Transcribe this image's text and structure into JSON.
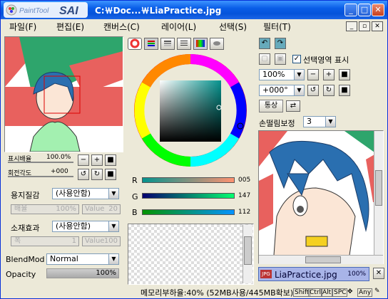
{
  "window": {
    "title": "C:￦Doc...￦LiaPractice.jpg",
    "logo_text": "PaintTool SAI"
  },
  "menu": [
    "파일(F)",
    "편집(E)",
    "캔버스(C)",
    "레이어(L)",
    "선택(S)",
    "필터(T)"
  ],
  "nav": {
    "zoom_label": "표시배율",
    "zoom_value": "100.0%",
    "angle_label": "회전각도",
    "angle_value": "+000"
  },
  "paper": {
    "texture_label": "용지질감",
    "texture_value": "(사용안함)",
    "scale_label": "배율",
    "scale_value": "100%",
    "value_label": "Value",
    "value_num": "20"
  },
  "effect": {
    "label": "소재효과",
    "value": "(사용안함)",
    "width_label": "폭",
    "width_value": "1",
    "value_label": "Value",
    "value_num": "100"
  },
  "blend": {
    "label": "BlendMod",
    "value": "Normal",
    "opacity_label": "Opacity",
    "opacity_value": "100%"
  },
  "rgb": {
    "r_label": "R",
    "r": "005",
    "g_label": "G",
    "g": "147",
    "b_label": "B",
    "b": "112"
  },
  "right": {
    "selection_label": "선택영역 표시",
    "zoom": "100%",
    "angle": "+000°",
    "normal_btn": "통상",
    "stabilizer_label": "손떨림보정",
    "stabilizer_value": "3"
  },
  "doc": {
    "name": "LiaPractice.jpg",
    "zoom": "100%",
    "badge": "JPG"
  },
  "status": {
    "memory": "메모리부하율:40% (52MB사용/445MB확보)",
    "keys": [
      "Shift",
      "Ctrl",
      "Alt",
      "SPC",
      "Any"
    ]
  },
  "colors": {
    "title": "#0a5ee8",
    "accent": "#316ac5"
  }
}
